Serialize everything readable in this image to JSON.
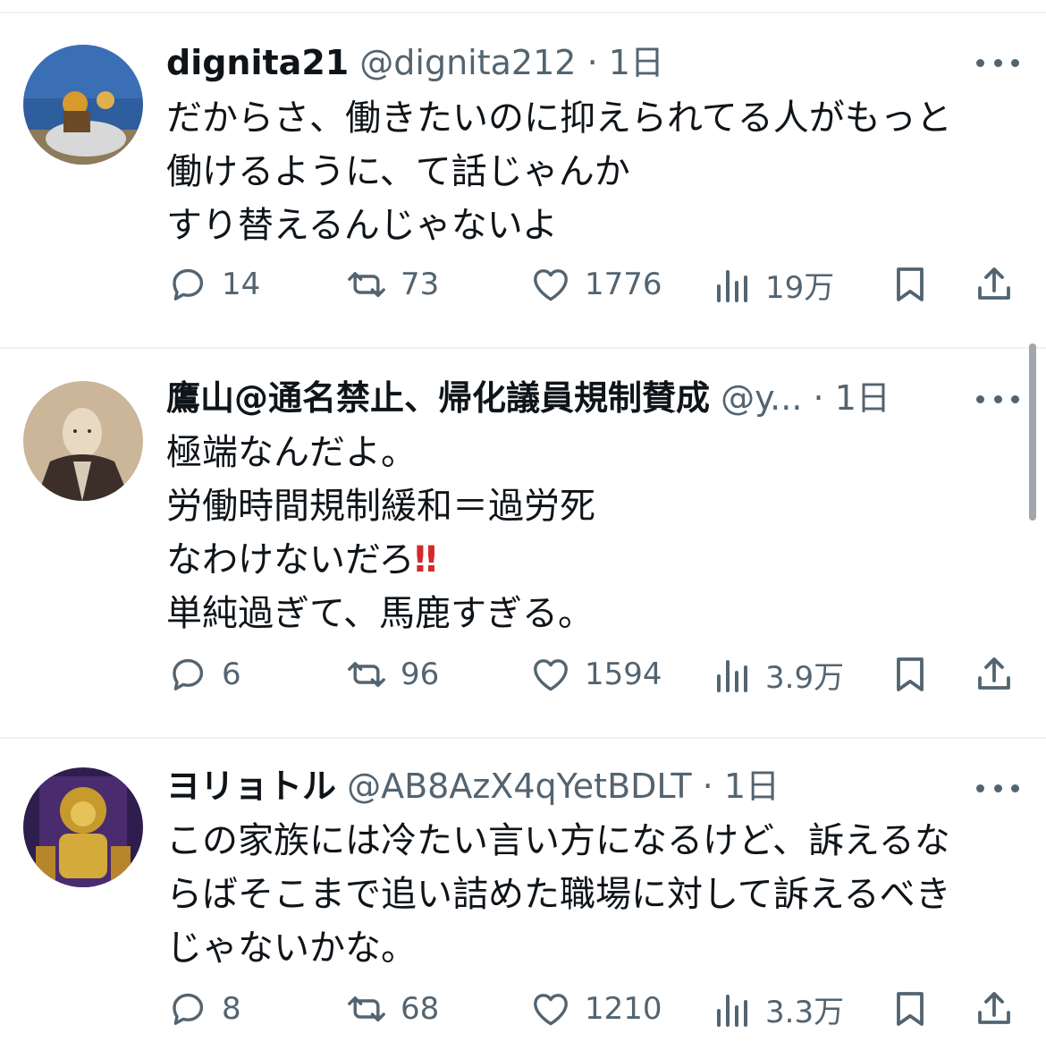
{
  "posts": [
    {
      "name": "dignita21",
      "handle": "@dignita212",
      "separator": "·",
      "time": "1日",
      "lines": [
        "だからさ、働きたいのに抑えられてる人がもっと",
        "働けるように、て話じゃんか",
        "すり替えるんじゃないよ"
      ],
      "stats": {
        "replies": "14",
        "reposts": "73",
        "likes": "1776",
        "views": "19万"
      }
    },
    {
      "name": "鷹山@通名禁止、帰化議員規制賛成",
      "handle": "@y...",
      "separator": "·",
      "time": "1日",
      "lines": [
        "極端なんだよ。",
        "労働時間規制緩和＝過労死",
        "なわけないだろ",
        "単純過ぎて、馬鹿すぎる。"
      ],
      "emoji": "‼",
      "stats": {
        "replies": "6",
        "reposts": "96",
        "likes": "1594",
        "views": "3.9万"
      }
    },
    {
      "name": "ヨリョトル",
      "handle": "@AB8AzX4qYetBDLT",
      "separator": "·",
      "time": "1日",
      "lines": [
        "この家族には冷たい言い方になるけど、訴えるな",
        "らばそこまで追い詰めた職場に対して訴えるべき",
        "じゃないかな。"
      ],
      "stats": {
        "replies": "8",
        "reposts": "68",
        "likes": "1210",
        "views": "3.3万"
      }
    }
  ],
  "icons": [
    "reply-icon",
    "repost-icon",
    "like-icon",
    "views-icon",
    "bookmark-icon",
    "share-icon",
    "more-icon"
  ],
  "colors": {
    "text": "#0f1419",
    "secondary": "#536471",
    "divider": "#eff3f4",
    "emoji": "#d42a2a"
  }
}
